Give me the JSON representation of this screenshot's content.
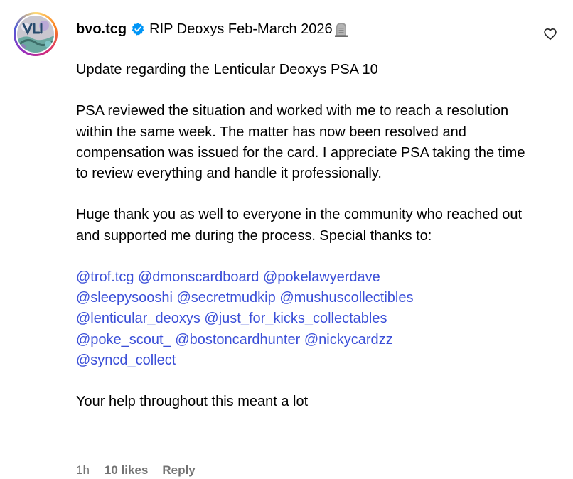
{
  "comment": {
    "username": "bvo.tcg",
    "status_text": "RIP Deoxys Feb-March 2026",
    "status_emoji": "headstone-icon",
    "verified": true,
    "paragraphs": {
      "p1": "Update regarding the Lenticular Deoxys PSA 10",
      "p2": "PSA reviewed the situation and worked with me to reach a resolution within the same week. The matter has now been resolved and compensation was issued for the card. I appreciate PSA taking the time to review everything and handle it professionally.",
      "p3": "Huge thank you as well to everyone in the community who reached out and supported me during the process. Special thanks to:",
      "p4": "Your help throughout this meant a lot"
    },
    "mentions": [
      "@trof.tcg",
      "@dmonscardboard",
      "@pokelawyerdave",
      "@sleepysooshi",
      "@secretmudkip",
      "@mushuscollectibles",
      "@lenticular_deoxys",
      "@just_for_kicks_collectables",
      "@poke_scout_",
      "@bostoncardhunter",
      "@nickycardzz",
      "@syncd_collect"
    ],
    "footer": {
      "time": "1h",
      "likes": "10 likes",
      "reply": "Reply"
    }
  },
  "colors": {
    "mention": "#3b4fd8",
    "verified": "#0095f6",
    "muted": "#737373"
  }
}
